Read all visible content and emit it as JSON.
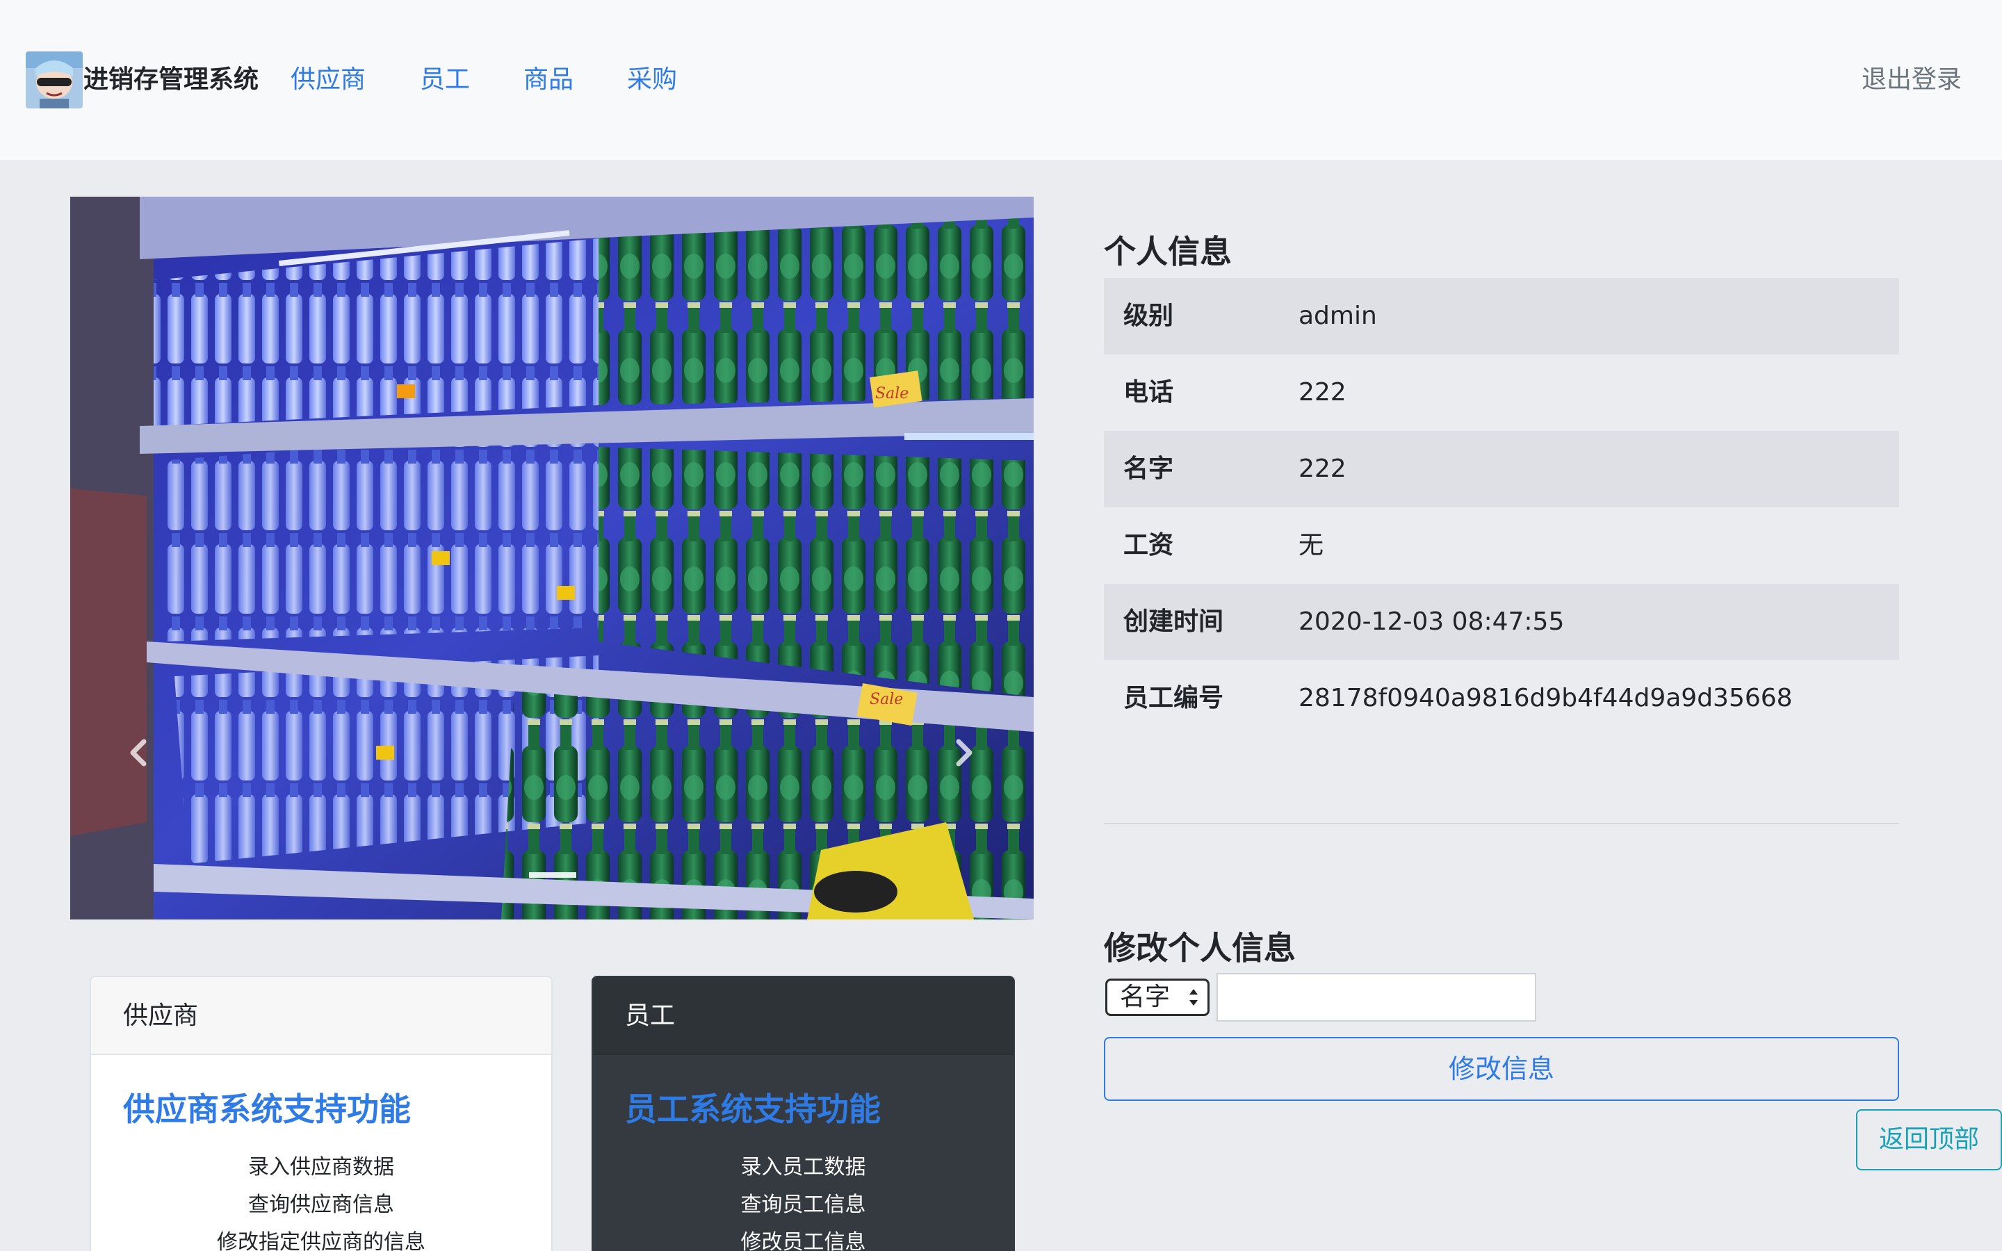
{
  "navbar": {
    "brand": "进销存管理系统",
    "links": [
      "供应商",
      "员工",
      "商品",
      "采购"
    ],
    "logout": "退出登录"
  },
  "carousel": {
    "prev_icon": "chevron-left-icon",
    "next_icon": "chevron-right-icon",
    "price_tags": [
      "Sale",
      "Sale"
    ]
  },
  "cards": [
    {
      "header": "供应商",
      "title": "供应商系统支持功能",
      "items": [
        "录入供应商数据",
        "查询供应商信息",
        "修改指定供应商的信息"
      ]
    },
    {
      "header": "员工",
      "title": "员工系统支持功能",
      "items": [
        "录入员工数据",
        "查询员工信息",
        "修改员工信息"
      ]
    }
  ],
  "profile": {
    "title": "个人信息",
    "rows": [
      {
        "key": "级别",
        "value": "admin"
      },
      {
        "key": "电话",
        "value": "222"
      },
      {
        "key": "名字",
        "value": "222"
      },
      {
        "key": "工资",
        "value": "无"
      },
      {
        "key": "创建时间",
        "value": "2020-12-03 08:47:55"
      },
      {
        "key": "员工编号",
        "value": "28178f0940a9816d9b4f44d9a9d35668"
      }
    ]
  },
  "edit": {
    "title": "修改个人信息",
    "field_selected": "名字",
    "input_value": "",
    "submit": "修改信息"
  },
  "back_to_top": "返回顶部",
  "colors": {
    "link": "#2f7be5",
    "navbar_bg": "#f8f9fa",
    "page_bg": "#ebecf0",
    "dark_card": "#343a40",
    "info": "#17a2b8"
  }
}
